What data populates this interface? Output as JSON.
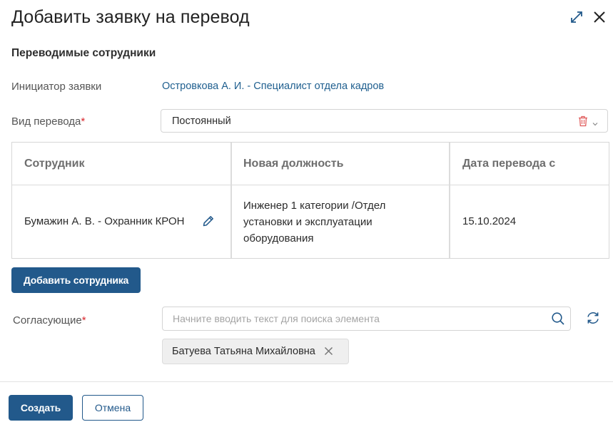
{
  "dialog": {
    "title": "Добавить заявку на перевод",
    "section_title": "Переводимые сотрудники"
  },
  "initiator": {
    "label": "Инициатор заявки",
    "value": "Островкова А. И. -  Специалист отдела кадров"
  },
  "transfer_type": {
    "label": "Вид перевода",
    "required_mark": "*",
    "value": "Постоянный"
  },
  "table": {
    "columns": [
      "Сотрудник",
      "Новая должность",
      "Дата перевода с"
    ],
    "rows": [
      {
        "employee": "Бумажин А. В. - Охранник КРОН",
        "position_lines": [
          "Инженер 1 категории /Отдел",
          "установки и эксплуатации",
          "оборудования"
        ],
        "date": "15.10.2024"
      }
    ]
  },
  "add_employee_button": "Добавить сотрудника",
  "approvers": {
    "label": "Согласующие",
    "required_mark": "*",
    "placeholder": "Начните вводить текст для поиска элемента",
    "selected": [
      "Батуева Татьяна Михайловна"
    ]
  },
  "footer": {
    "create_button": "Создать",
    "cancel_button": "Отмена"
  },
  "colors": {
    "primary": "#22598b",
    "link": "#1f5f8f",
    "required": "#d9262c",
    "delete_icon": "#e05a5a"
  },
  "icons": {
    "expand": "expand-icon",
    "close": "close-icon",
    "trash": "trash-icon",
    "chevron": "chevron-down-icon",
    "edit": "pencil-icon",
    "search": "search-icon",
    "refresh": "refresh-icon",
    "remove_chip": "close-small-icon"
  }
}
